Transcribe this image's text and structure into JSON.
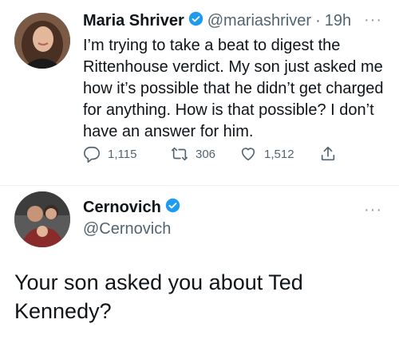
{
  "tweet1": {
    "name": "Maria Shriver",
    "handle": "@mariashriver",
    "separator": "·",
    "time": "19h",
    "more": "···",
    "text": "I’m trying to take a beat to digest the Rittenhouse verdict. My son just asked me how it’s possible that he didn’t get charged for anything. How is that possible? I don’t have an answer for him.",
    "replies": "1,115",
    "retweets": "306",
    "likes": "1,512"
  },
  "tweet2": {
    "name": "Cernovich",
    "handle": "@Cernovich",
    "more": "···",
    "text": "Your son asked you about Ted Kennedy?"
  },
  "colors": {
    "verified": "#1d9bf0",
    "secondary_text": "#536471",
    "primary_text": "#0f1419"
  },
  "icons": [
    "verified-badge-icon",
    "reply-icon",
    "retweet-icon",
    "like-icon",
    "share-icon",
    "more-icon"
  ]
}
